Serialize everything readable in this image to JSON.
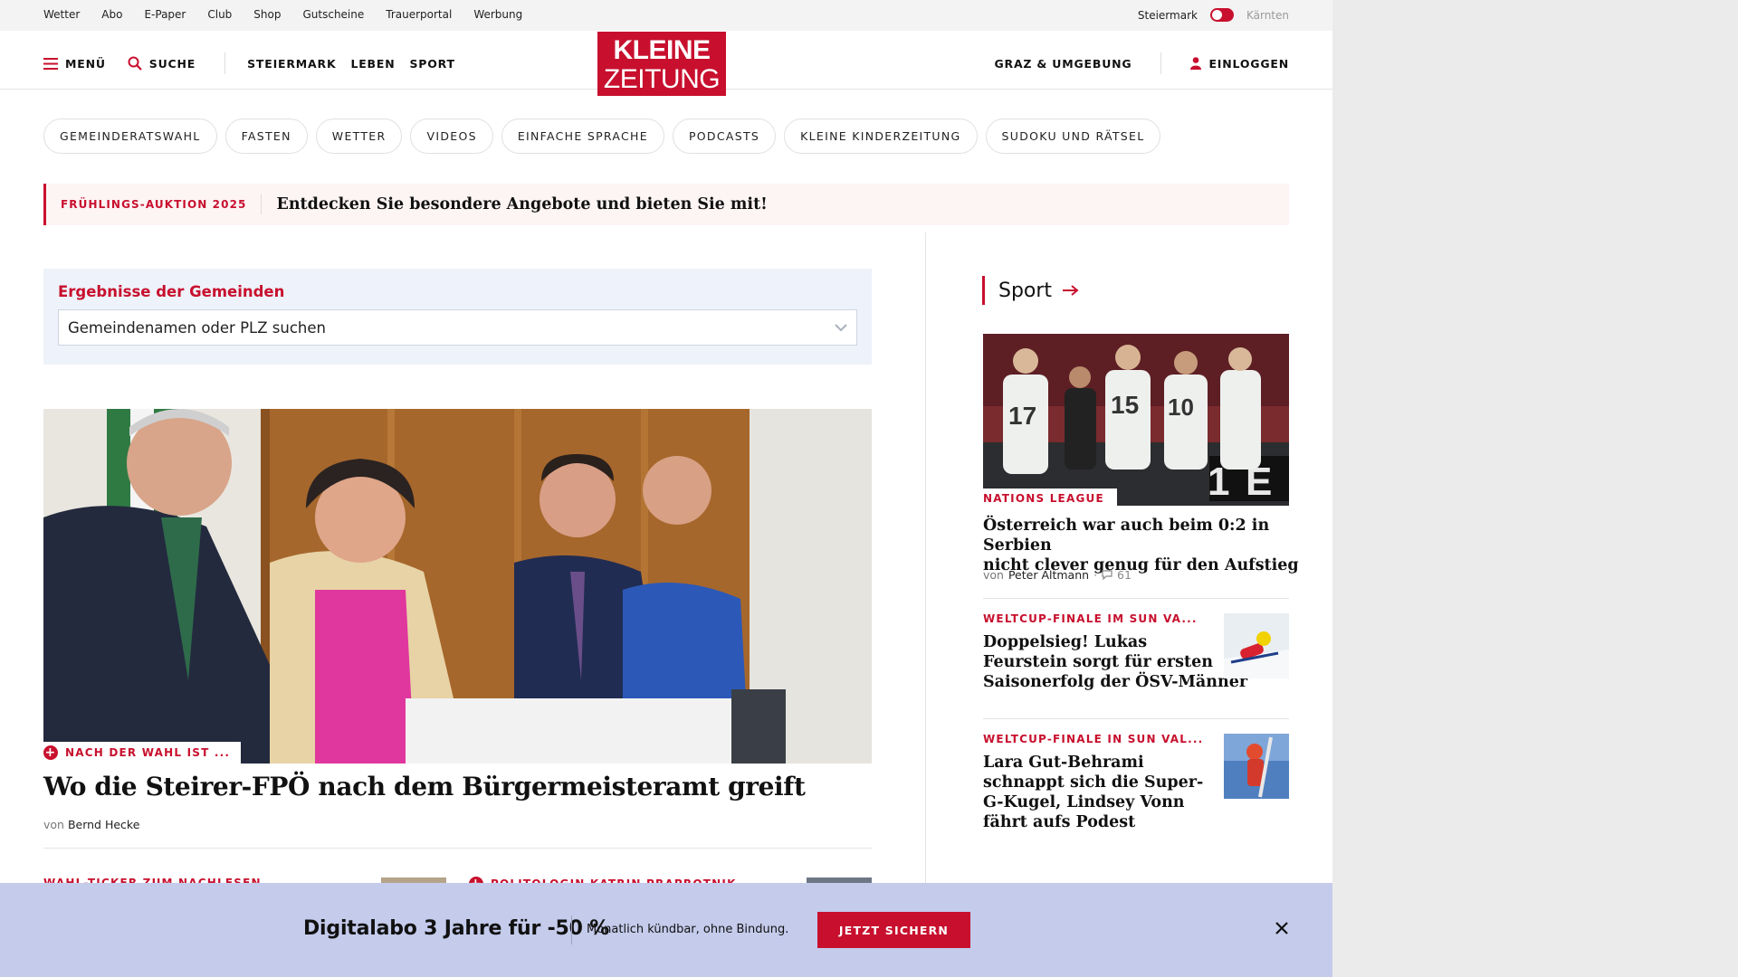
{
  "utility": {
    "links": [
      "Wetter",
      "Abo",
      "E-Paper",
      "Club",
      "Shop",
      "Gutscheine",
      "Trauerportal",
      "Werbung"
    ],
    "region_active": "Steiermark",
    "region_inactive": "Kärnten"
  },
  "header": {
    "menu_label": "MENÜ",
    "search_label": "SUCHE",
    "nav": [
      "STEIERMARK",
      "LEBEN",
      "SPORT"
    ],
    "logo_line1": "KLEINE",
    "logo_line2": "ZEITUNG",
    "region_link": "GRAZ & UMGEBUNG",
    "login_label": "EINLOGGEN"
  },
  "chips": [
    "GEMEINDERATSWAHL",
    "FASTEN",
    "WETTER",
    "VIDEOS",
    "EINFACHE SPRACHE",
    "PODCASTS",
    "KLEINE KINDERZEITUNG",
    "SUDOKU UND RÄTSEL"
  ],
  "promo": {
    "tag": "FRÜHLINGS-AUKTION 2025",
    "text": "Entdecken Sie besondere Angebote und bieten Sie mit!"
  },
  "municipalities": {
    "title": "Ergebnisse der Gemeinden",
    "placeholder": "Gemeindenamen oder PLZ suchen"
  },
  "hero": {
    "kicker": "NACH DER WAHL IST ...",
    "title": "Wo die Steirer-FPÖ nach dem Bürgermeisteramt greift",
    "by": "von",
    "author": "Bernd Hecke"
  },
  "peek": {
    "left_kicker": "WAHL-TICKER ZUM NACHLESEN",
    "right_kicker": "POLITOLOGIN KATRIN PRAPROTNIK"
  },
  "sport": {
    "section_title": "Sport",
    "lead": {
      "kicker": "NATIONS LEAGUE",
      "title_lines": [
        "Österreich war auch beim 0:2 in Serbien",
        "nicht clever genug für den Aufstieg"
      ],
      "by": "von",
      "author": "Peter Altmann",
      "comments": "61"
    },
    "items": [
      {
        "kicker": "WELTCUP-FINALE IM SUN VA...",
        "title_lines": [
          "Doppelsieg! Lukas",
          "Feurstein sorgt für ersten",
          "Saisonerfolg der ÖSV-Männer"
        ]
      },
      {
        "kicker": "WELTCUP-FINALE IN SUN VAL...",
        "title_lines": [
          "Lara Gut-Behrami",
          "schnappt sich die Super-",
          "G-Kugel, Lindsey Vonn",
          "fährt aufs Podest"
        ]
      }
    ]
  },
  "bottom_bar": {
    "headline": "Digitalabo 3 Jahre für -50 %",
    "subtext": "Monatlich kündbar, ohne Bindung.",
    "cta": "JETZT SICHERN"
  },
  "icons": {
    "menu": "hamburger-icon",
    "search": "search-icon",
    "user": "user-icon",
    "chevron": "chevron-down-icon",
    "arrow": "arrow-right-icon",
    "plus": "plus-circle-icon",
    "comment": "comment-icon",
    "close": "close-icon"
  },
  "colors": {
    "brand_red": "#c8102e",
    "promo_bg": "#fdf4f4",
    "muni_bg": "#eef2fa",
    "bottom_bar_bg": "#c4cbeb"
  }
}
